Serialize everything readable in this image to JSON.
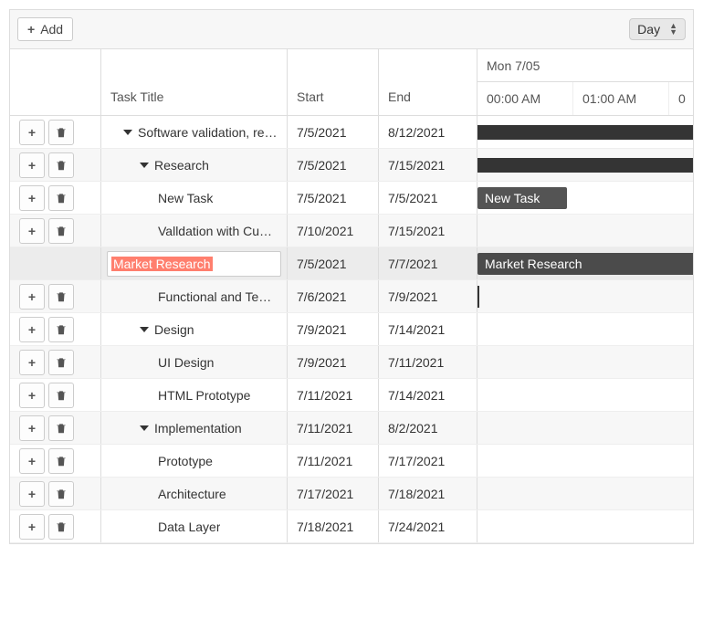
{
  "toolbar": {
    "add_label": "Add",
    "view_value": "Day"
  },
  "tree_headers": {
    "title": "Task Title",
    "start": "Start",
    "end": "End"
  },
  "timeline": {
    "top": "Mon 7/05",
    "ticks": [
      "00:00 AM",
      "01:00 AM",
      "0"
    ]
  },
  "rows": [
    {
      "title": "Software validation, re…",
      "start": "7/5/2021",
      "end": "8/12/2021",
      "level": 1,
      "summary": true,
      "buttons": true,
      "bar": "summary"
    },
    {
      "title": "Research",
      "start": "7/5/2021",
      "end": "7/15/2021",
      "level": 2,
      "summary": true,
      "buttons": true,
      "bar": "summary"
    },
    {
      "title": "New Task",
      "start": "7/5/2021",
      "end": "7/5/2021",
      "level": 3,
      "summary": false,
      "buttons": true,
      "bar": "task",
      "bar_label": "New Task"
    },
    {
      "title": "Valldation with Cu…",
      "start": "7/10/2021",
      "end": "7/15/2021",
      "level": 3,
      "summary": false,
      "buttons": true,
      "bar": "none"
    },
    {
      "title": "Market Research",
      "start": "7/5/2021",
      "end": "7/7/2021",
      "level": 1,
      "summary": false,
      "buttons": false,
      "bar": "task",
      "bar_label": "Market Research",
      "editing": true
    },
    {
      "title": "Functional and Te…",
      "start": "7/6/2021",
      "end": "7/9/2021",
      "level": 3,
      "summary": false,
      "buttons": true,
      "bar": "line"
    },
    {
      "title": "Design",
      "start": "7/9/2021",
      "end": "7/14/2021",
      "level": 2,
      "summary": true,
      "buttons": true,
      "bar": "none"
    },
    {
      "title": "UI Design",
      "start": "7/9/2021",
      "end": "7/11/2021",
      "level": 3,
      "summary": false,
      "buttons": true,
      "bar": "none"
    },
    {
      "title": "HTML Prototype",
      "start": "7/11/2021",
      "end": "7/14/2021",
      "level": 3,
      "summary": false,
      "buttons": true,
      "bar": "none"
    },
    {
      "title": "Implementation",
      "start": "7/11/2021",
      "end": "8/2/2021",
      "level": 2,
      "summary": true,
      "buttons": true,
      "bar": "none"
    },
    {
      "title": "Prototype",
      "start": "7/11/2021",
      "end": "7/17/2021",
      "level": 3,
      "summary": false,
      "buttons": true,
      "bar": "none"
    },
    {
      "title": "Architecture",
      "start": "7/17/2021",
      "end": "7/18/2021",
      "level": 3,
      "summary": false,
      "buttons": true,
      "bar": "none"
    },
    {
      "title": "Data Layer",
      "start": "7/18/2021",
      "end": "7/24/2021",
      "level": 3,
      "summary": false,
      "buttons": true,
      "bar": "none"
    }
  ]
}
